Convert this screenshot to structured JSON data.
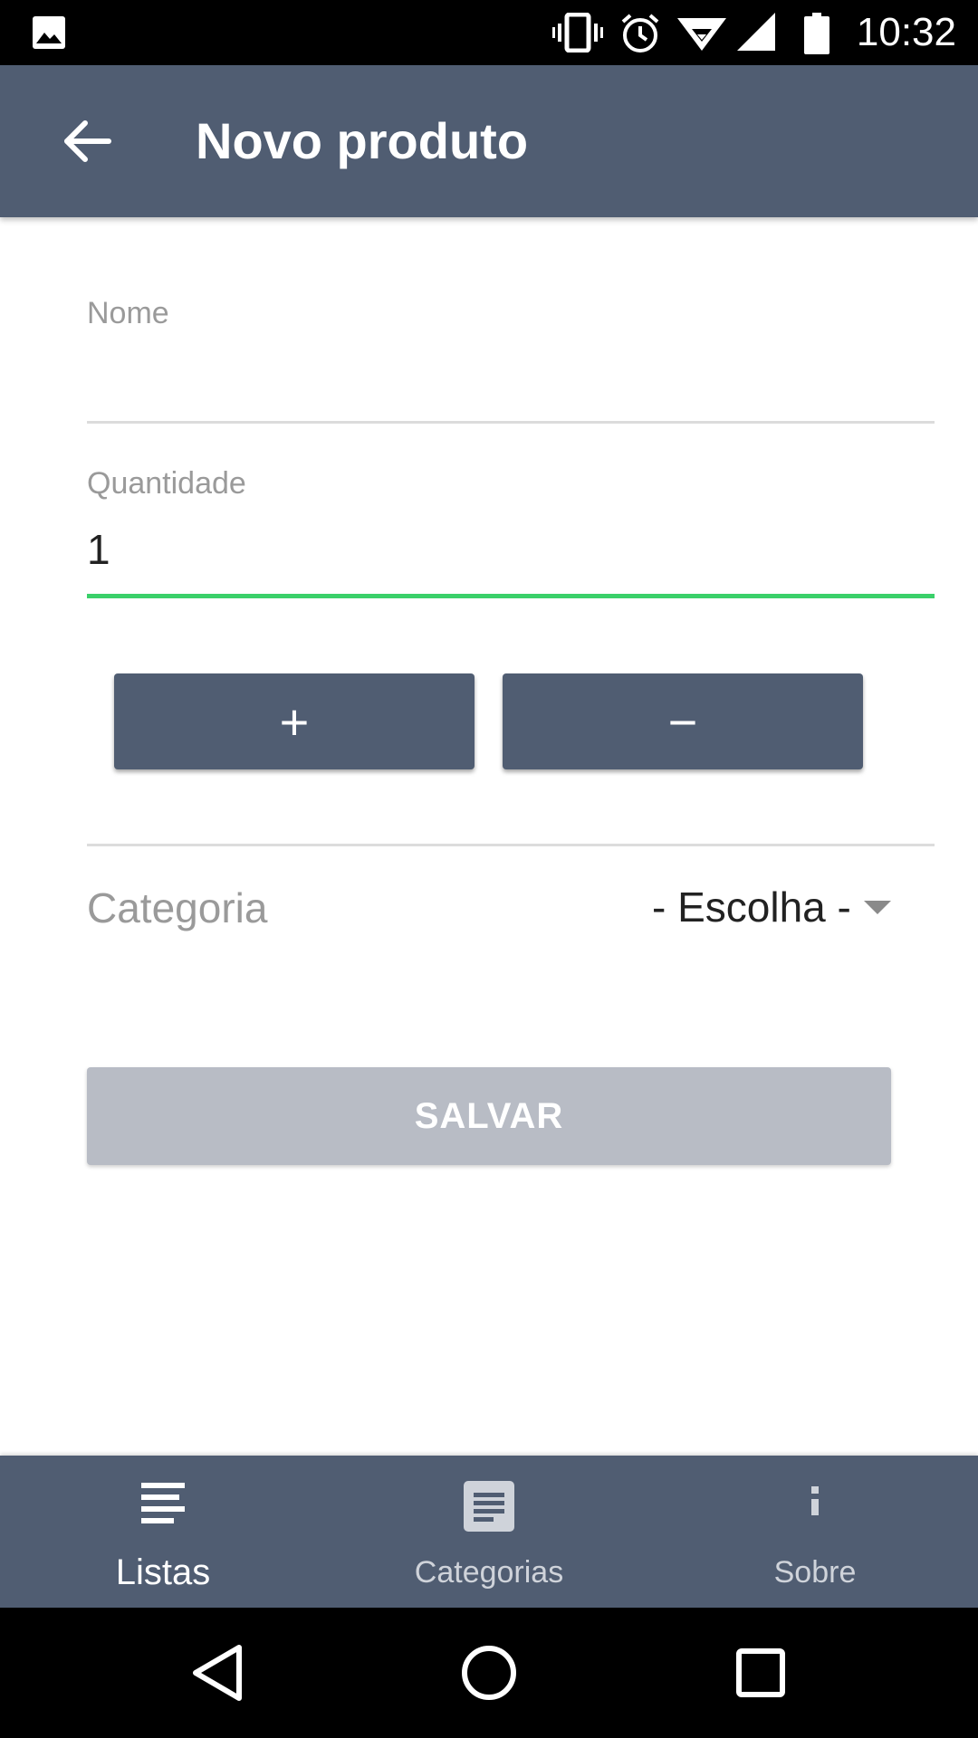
{
  "status_bar": {
    "time": "10:32",
    "icons": [
      "image-icon",
      "vibrate-icon",
      "alarm-icon",
      "wifi-icon",
      "signal-icon",
      "battery-icon"
    ]
  },
  "app_bar": {
    "back_icon": "arrow-back-icon",
    "title": "Novo produto"
  },
  "form": {
    "name_label": "Nome",
    "name_value": "",
    "quantity_label": "Quantidade",
    "quantity_value": "1",
    "increment_label": "+",
    "decrement_label": "−",
    "category_label": "Categoria",
    "category_value": "- Escolha -",
    "save_label": "SALVAR"
  },
  "bottom_nav": {
    "items": [
      {
        "label": "Listas",
        "icon": "list-icon",
        "active": true
      },
      {
        "label": "Categorias",
        "icon": "document-icon",
        "active": false
      },
      {
        "label": "Sobre",
        "icon": "info-icon",
        "active": false
      }
    ]
  },
  "system_nav": {
    "icons": [
      "back-triangle-icon",
      "home-circle-icon",
      "recents-square-icon"
    ]
  },
  "colors": {
    "primary": "#505d72",
    "accent": "#3ad06a",
    "disabled_button": "#b8bcc5"
  }
}
